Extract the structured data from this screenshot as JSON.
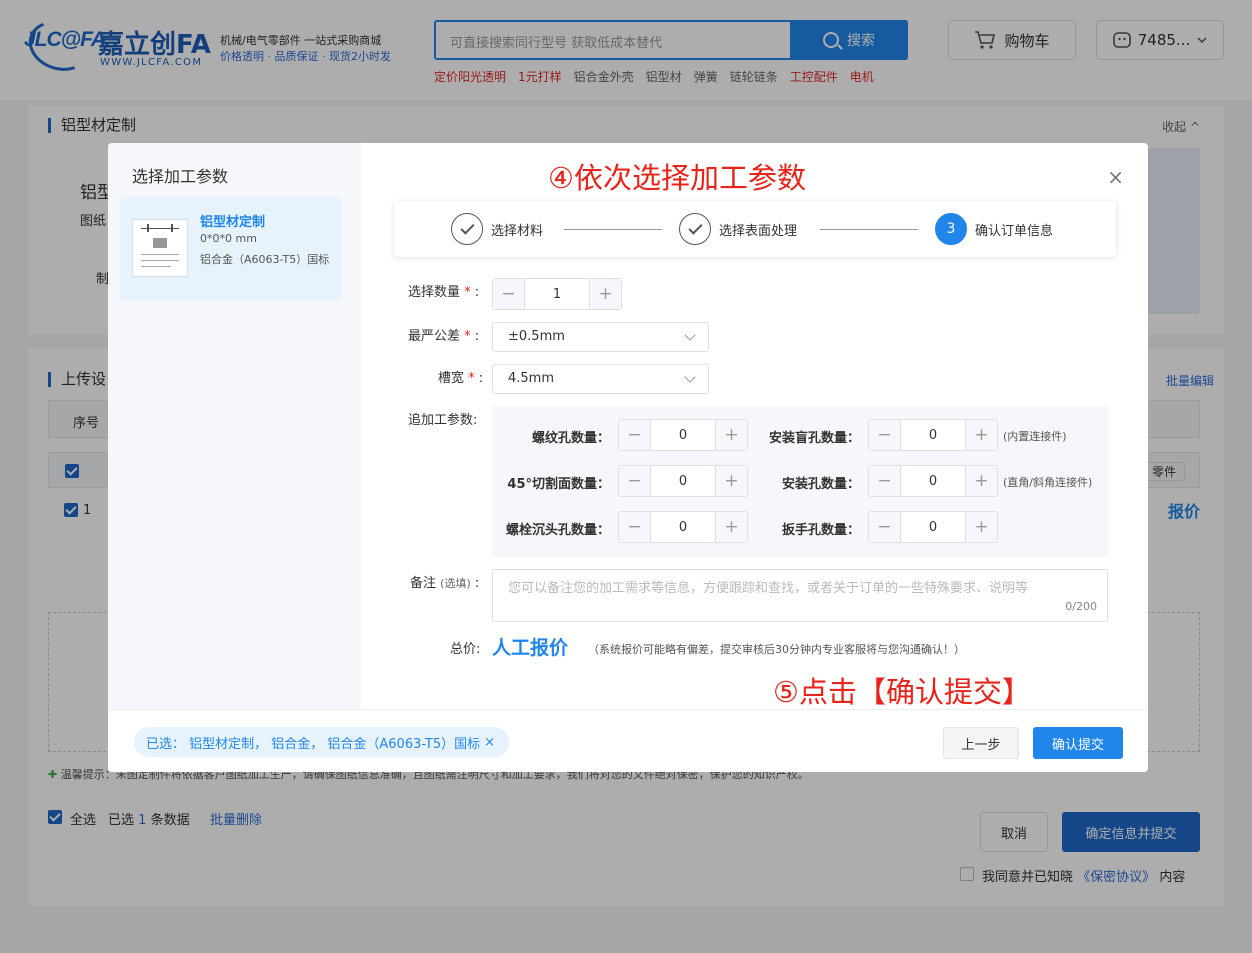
{
  "header": {
    "logo_mark": "JLC@FA",
    "logo_cn": "嘉立创FA",
    "logo_url": "WWW.JLCFA.COM",
    "tagline1": "机械/电气零部件  一站式采购商城",
    "tagline2": "价格透明 · 品质保证 · 现货2小时发",
    "search_placeholder": "可直接搜索同行型号 获取低成本替代",
    "search_button": "搜索",
    "hot_links": [
      {
        "label": "定价阳光透明",
        "hot": true
      },
      {
        "label": "1元打样",
        "hot": true
      },
      {
        "label": "铝合金外壳",
        "hot": false
      },
      {
        "label": "铝型材",
        "hot": false
      },
      {
        "label": "弹簧",
        "hot": false
      },
      {
        "label": "链轮链条",
        "hot": false
      },
      {
        "label": "工控配件",
        "hot": true
      },
      {
        "label": "电机",
        "hot": true
      }
    ],
    "cart_label": "购物车",
    "user_label": "7485..."
  },
  "background": {
    "section1_title": "铝型材定制",
    "collapse_label": "收起",
    "section1_stub1": "铝型",
    "section1_stub2": "图纸",
    "section1_stub3": "制",
    "section2_title": "上传设",
    "batch_edit": "批量编辑",
    "col_index": "序号",
    "row_index": "1",
    "parts_btn": "零件",
    "quote_link": "报价",
    "tip": "温馨提示：未图定制件将依据客户图纸加工生产，请确保图纸信息准确，且图纸需注明尺寸和加工要求，我们将对您的文件绝对保密，保护您的知识产权。",
    "select_all": "全选",
    "selected_prefix": "已选",
    "selected_count": "1",
    "selected_suffix": "条数据",
    "batch_delete": "批量删除",
    "cancel_btn": "取消",
    "confirm_submit_btn": "确定信息并提交",
    "agree_prefix": "我同意并已知晓",
    "agree_link": "《保密协议》",
    "agree_suffix": "内容"
  },
  "modal": {
    "left_title": "选择加工参数",
    "product": {
      "name": "铝型材定制",
      "dims": "0*0*0 mm",
      "material": "铝合金（A6063-T5）国标"
    },
    "annotation_top": "④依次选择加工参数",
    "annotation_bottom": "⑤点击【确认提交】",
    "close_label": "×",
    "steps": [
      {
        "label": "选择材料",
        "state": "done"
      },
      {
        "label": "选择表面处理",
        "state": "done"
      },
      {
        "label": "确认订单信息",
        "state": "active",
        "num": "3"
      }
    ],
    "quantity_label": "选择数量",
    "quantity_value": "1",
    "tolerance_label": "最严公差",
    "tolerance_value": "±0.5mm",
    "slot_label": "槽宽",
    "slot_value": "4.5mm",
    "extra_label": "追加工参数:",
    "required_mark": "*",
    "colon": ":",
    "minus": "−",
    "plus": "+",
    "extras": [
      {
        "label": "螺纹孔数量：",
        "value": "0",
        "note": ""
      },
      {
        "label": "安装盲孔数量：",
        "value": "0",
        "note": "(内置连接件)"
      },
      {
        "label": "45°切割面数量：",
        "value": "0",
        "note": ""
      },
      {
        "label": "安装孔数量：",
        "value": "0",
        "note": "(直角/斜角连接件)"
      },
      {
        "label": "螺栓沉头孔数量：",
        "value": "0",
        "note": ""
      },
      {
        "label": "扳手孔数量：",
        "value": "0",
        "note": ""
      }
    ],
    "remark_label": "备注",
    "remark_optional": "(选填)",
    "remark_placeholder": "您可以备注您的加工需求等信息，方便跟踪和查找，或者关于订单的一些特殊要求、说明等",
    "remark_count": "0/200",
    "total_label": "总价:",
    "total_value": "人工报价",
    "total_note": "（系统报价可能略有偏差，提交审核后30分钟内专业客服将与您沟通确认！）",
    "selected_tag": "已选： 铝型材定制， 铝合金， 铝合金（A6063-T5）国标",
    "tag_close": "×",
    "prev_btn": "上一步",
    "confirm_btn": "确认提交"
  },
  "colors": {
    "accent": "#2186ea",
    "brand": "#1e67c9",
    "annotation": "#e8231a"
  }
}
